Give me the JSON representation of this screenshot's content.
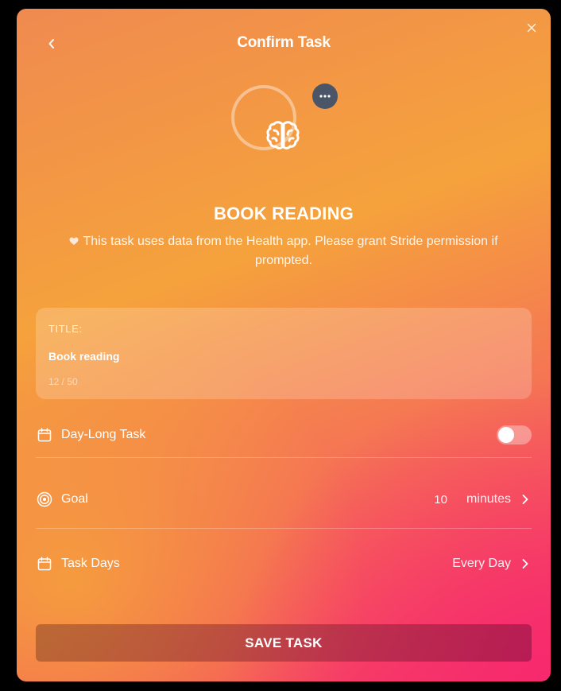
{
  "header": {
    "title": "Confirm Task",
    "back_icon": "chevron-left-icon",
    "close_icon": "close-icon"
  },
  "task_icon": {
    "icon": "brain-icon",
    "more_icon": "ellipsis-icon"
  },
  "task_name": "BOOK READING",
  "health_note": "This task uses data from the Health app. Please grant Stride permission if prompted.",
  "title_field": {
    "label": "TITLE:",
    "value": "Book reading",
    "count": "12 / 50"
  },
  "rows": {
    "day_long": {
      "label": "Day-Long Task",
      "enabled": false
    },
    "goal": {
      "label": "Goal",
      "value": "10",
      "unit": "minutes"
    },
    "task_days": {
      "label": "Task Days",
      "value": "Every Day"
    }
  },
  "save_button": "SAVE TASK",
  "colors": {
    "gradient_start": "#f08a50",
    "gradient_mid": "#f5a23c",
    "gradient_end": "#f5356a",
    "more_button_bg": "#4a5668"
  }
}
